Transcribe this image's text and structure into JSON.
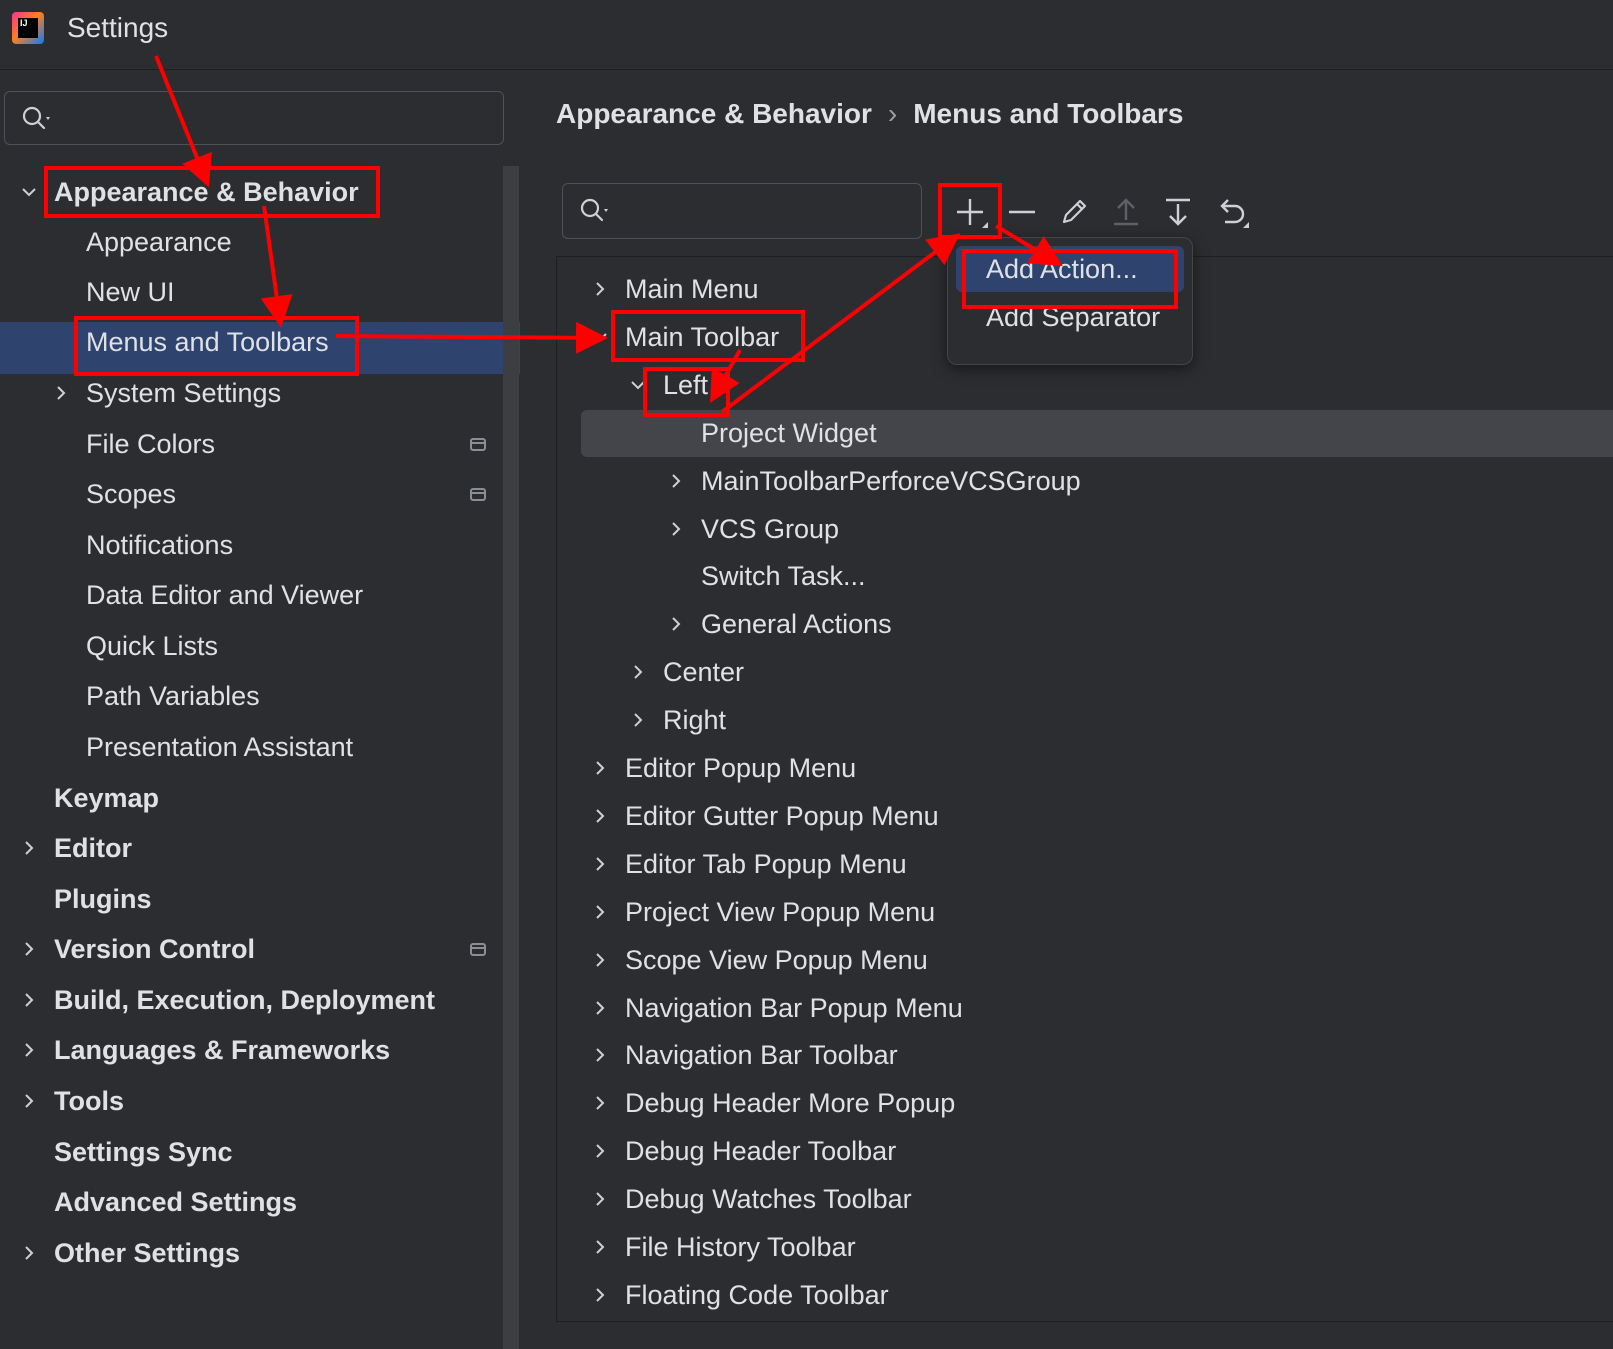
{
  "window": {
    "title": "Settings",
    "logo_text": "IJ"
  },
  "sidebar": {
    "search_placeholder": "",
    "items": [
      {
        "label": "Appearance & Behavior",
        "bold": true,
        "expander": "expanded"
      },
      {
        "label": "Appearance",
        "bold": false,
        "expander": "none"
      },
      {
        "label": "New UI",
        "bold": false,
        "expander": "none"
      },
      {
        "label": "Menus and Toolbars",
        "bold": false,
        "expander": "none",
        "selected": true
      },
      {
        "label": "System Settings",
        "bold": false,
        "expander": "collapsed"
      },
      {
        "label": "File Colors",
        "bold": false,
        "expander": "none",
        "project_icon": true
      },
      {
        "label": "Scopes",
        "bold": false,
        "expander": "none",
        "project_icon": true
      },
      {
        "label": "Notifications",
        "bold": false,
        "expander": "none"
      },
      {
        "label": "Data Editor and Viewer",
        "bold": false,
        "expander": "none"
      },
      {
        "label": "Quick Lists",
        "bold": false,
        "expander": "none"
      },
      {
        "label": "Path Variables",
        "bold": false,
        "expander": "none"
      },
      {
        "label": "Presentation Assistant",
        "bold": false,
        "expander": "none"
      },
      {
        "label": "Keymap",
        "bold": true,
        "expander": "none"
      },
      {
        "label": "Editor",
        "bold": true,
        "expander": "collapsed"
      },
      {
        "label": "Plugins",
        "bold": true,
        "expander": "none"
      },
      {
        "label": "Version Control",
        "bold": true,
        "expander": "collapsed",
        "project_icon": true
      },
      {
        "label": "Build, Execution, Deployment",
        "bold": true,
        "expander": "collapsed"
      },
      {
        "label": "Languages & Frameworks",
        "bold": true,
        "expander": "collapsed"
      },
      {
        "label": "Tools",
        "bold": true,
        "expander": "collapsed"
      },
      {
        "label": "Settings Sync",
        "bold": true,
        "expander": "none"
      },
      {
        "label": "Advanced Settings",
        "bold": true,
        "expander": "none"
      },
      {
        "label": "Other Settings",
        "bold": true,
        "expander": "collapsed"
      }
    ]
  },
  "breadcrumb": {
    "parent": "Appearance & Behavior",
    "separator": "›",
    "current": "Menus and Toolbars"
  },
  "toolbar": {
    "search_placeholder": "",
    "buttons": [
      {
        "name": "add-button",
        "icon": "plus-icon",
        "enabled": true
      },
      {
        "name": "remove-button",
        "icon": "minus-icon",
        "enabled": true
      },
      {
        "name": "edit-icon-button",
        "icon": "pencil-icon",
        "enabled": true
      },
      {
        "name": "move-up-button",
        "icon": "arrow-up-icon",
        "enabled": false
      },
      {
        "name": "move-down-button",
        "icon": "arrow-down-icon",
        "enabled": true
      },
      {
        "name": "restore-button",
        "icon": "undo-icon",
        "enabled": true
      }
    ]
  },
  "tree": [
    {
      "label": "Main Menu",
      "level": 0,
      "expander": "collapsed"
    },
    {
      "label": "Main Toolbar",
      "level": 0,
      "expander": "expanded"
    },
    {
      "label": "Left",
      "level": 1,
      "expander": "expanded"
    },
    {
      "label": "Project Widget",
      "level": 2,
      "expander": "none",
      "selected": true
    },
    {
      "label": "MainToolbarPerforceVCSGroup",
      "level": 2,
      "expander": "collapsed"
    },
    {
      "label": "VCS Group",
      "level": 2,
      "expander": "collapsed"
    },
    {
      "label": "Switch Task...",
      "level": 2,
      "expander": "none"
    },
    {
      "label": "General Actions",
      "level": 2,
      "expander": "collapsed"
    },
    {
      "label": "Center",
      "level": 1,
      "expander": "collapsed"
    },
    {
      "label": "Right",
      "level": 1,
      "expander": "collapsed"
    },
    {
      "label": "Editor Popup Menu",
      "level": 0,
      "expander": "collapsed"
    },
    {
      "label": "Editor Gutter Popup Menu",
      "level": 0,
      "expander": "collapsed"
    },
    {
      "label": "Editor Tab Popup Menu",
      "level": 0,
      "expander": "collapsed"
    },
    {
      "label": "Project View Popup Menu",
      "level": 0,
      "expander": "collapsed"
    },
    {
      "label": "Scope View Popup Menu",
      "level": 0,
      "expander": "collapsed"
    },
    {
      "label": "Navigation Bar Popup Menu",
      "level": 0,
      "expander": "collapsed"
    },
    {
      "label": "Navigation Bar Toolbar",
      "level": 0,
      "expander": "collapsed"
    },
    {
      "label": "Debug Header More Popup",
      "level": 0,
      "expander": "collapsed"
    },
    {
      "label": "Debug Header Toolbar",
      "level": 0,
      "expander": "collapsed"
    },
    {
      "label": "Debug Watches Toolbar",
      "level": 0,
      "expander": "collapsed"
    },
    {
      "label": "File History Toolbar",
      "level": 0,
      "expander": "collapsed"
    },
    {
      "label": "Floating Code Toolbar",
      "level": 0,
      "expander": "collapsed"
    }
  ],
  "popup": {
    "items": [
      {
        "label": "Add Action...",
        "selected": true
      },
      {
        "label": "Add Separator",
        "selected": false
      }
    ]
  },
  "colors": {
    "background": "#2b2d30",
    "selection": "#2e436e",
    "row_highlight": "#43454a",
    "annotation": "#ff0000",
    "text": "#dfe1e5"
  }
}
